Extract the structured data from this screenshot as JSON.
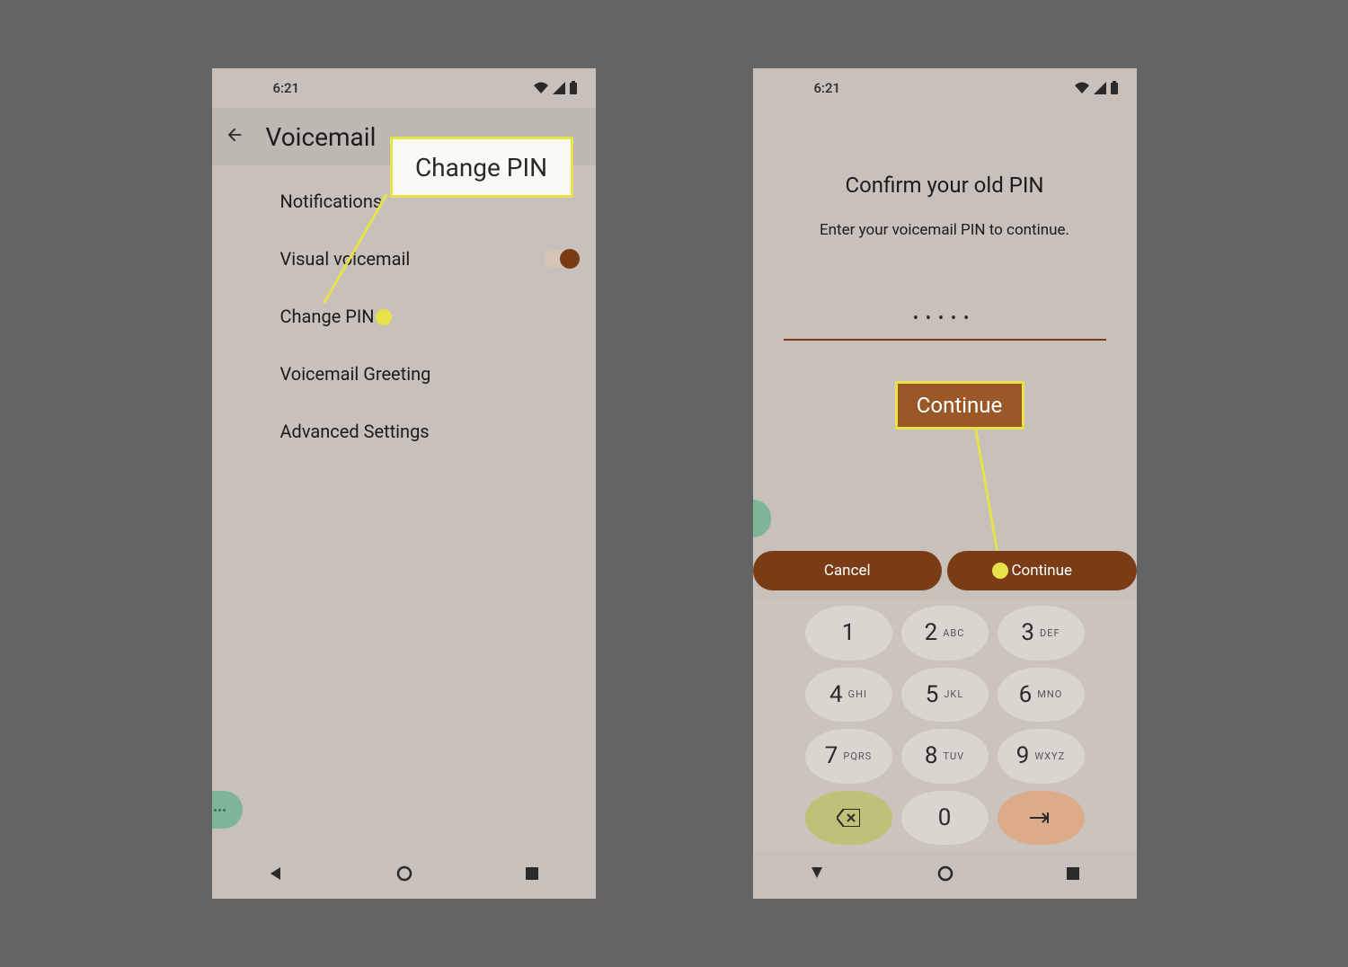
{
  "status": {
    "time": "6:21"
  },
  "phone1": {
    "title": "Voicemail",
    "items": {
      "notifications": "Notifications",
      "visual": "Visual voicemail",
      "changepin": "Change PIN",
      "greeting": "Voicemail Greeting",
      "advanced": "Advanced Settings"
    },
    "callout": "Change PIN"
  },
  "phone2": {
    "title": "Confirm your old PIN",
    "subtitle": "Enter your voicemail PIN to continue.",
    "pin_masked": "•••••",
    "cancel": "Cancel",
    "continue": "Continue",
    "callout": "Continue",
    "keys": {
      "k1": "1",
      "k2": "2",
      "k3": "3",
      "k4": "4",
      "k5": "5",
      "k6": "6",
      "k7": "7",
      "k8": "8",
      "k9": "9",
      "k0": "0",
      "l2": "ABC",
      "l3": "DEF",
      "l4": "GHI",
      "l5": "JKL",
      "l6": "MNO",
      "l7": "PQRS",
      "l8": "TUV",
      "l9": "WXYZ"
    }
  }
}
